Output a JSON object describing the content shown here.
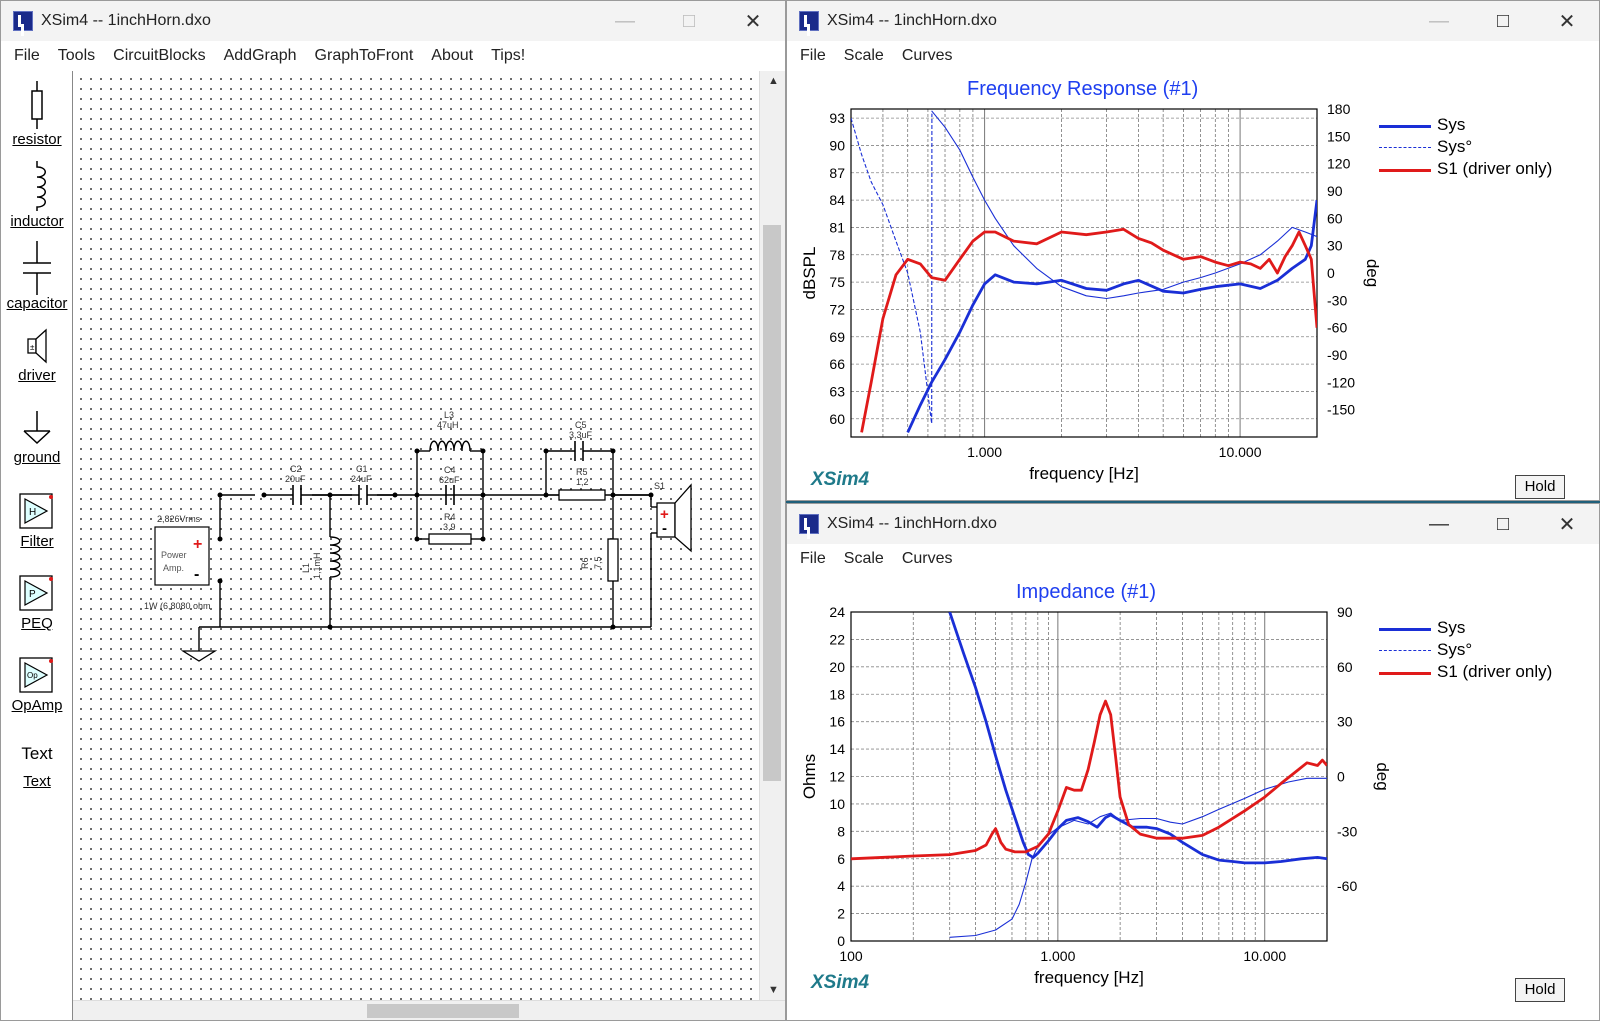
{
  "main_window": {
    "title": "XSim4 -- 1inchHorn.dxo",
    "menu": [
      "File",
      "Tools",
      "CircuitBlocks",
      "AddGraph",
      "GraphToFront",
      "About",
      "Tips!"
    ],
    "palette": [
      {
        "label": "resistor",
        "icon": "resistor-icon"
      },
      {
        "label": "inductor",
        "icon": "inductor-icon"
      },
      {
        "label": "capacitor",
        "icon": "capacitor-icon"
      },
      {
        "label": "driver",
        "icon": "driver-icon"
      },
      {
        "label": "ground",
        "icon": "ground-icon"
      },
      {
        "label": "Filter",
        "icon": "filter-icon"
      },
      {
        "label": "PEQ",
        "icon": "peq-icon"
      },
      {
        "label": "OpAmp",
        "icon": "opamp-icon"
      },
      {
        "label": "Text",
        "icon": "text-icon",
        "icon_text": "Text"
      }
    ],
    "schematic": {
      "source_voltage": "2,826Vrms",
      "amp_label_1": "Power",
      "amp_label_2": "Amp.",
      "amp_power": "1W (6,8080 ohm",
      "C2_name": "C2",
      "C2_value": "20uF",
      "C1_name": "C1",
      "C1_value": "24uF",
      "L1_name": "L1",
      "L1_value": "1,1mH",
      "L3_name": "L3",
      "L3_value": "47uH",
      "C4_name": "C4",
      "C4_value": "62uF",
      "R4_name": "R4",
      "R4_value": "3,9",
      "C5_name": "C5",
      "C5_value": "3,3uF",
      "R5_name": "R5",
      "R5_value": "1,2",
      "R6_name": "R6",
      "R6_value": "7,5",
      "S1_name": "S1"
    }
  },
  "fr_window": {
    "title": "XSim4 -- 1inchHorn.dxo",
    "menu": [
      "File",
      "Scale",
      "Curves"
    ],
    "logo": "XSim4",
    "hold": "Hold"
  },
  "imp_window": {
    "title": "XSim4 -- 1inchHorn.dxo",
    "menu": [
      "File",
      "Scale",
      "Curves"
    ],
    "logo": "XSim4",
    "hold": "Hold"
  },
  "colors": {
    "sys": "#1a2fd6",
    "driver": "#e01a1a",
    "title_blue": "#1f3ff0",
    "logo": "#1f7a8a"
  },
  "chart_data": [
    {
      "type": "line",
      "title": "Frequency Response (#1)",
      "xlabel": "frequency [Hz]",
      "ylabel": "dBSPL",
      "y2label": "deg",
      "xscale": "log",
      "xlim": [
        300,
        20000
      ],
      "ylim": [
        58,
        94
      ],
      "y2lim": [
        -180,
        180
      ],
      "xticks": [
        {
          "v": 1000,
          "label": "1.000"
        },
        {
          "v": 10000,
          "label": "10.000"
        }
      ],
      "yticks": [
        60,
        63,
        66,
        69,
        72,
        75,
        78,
        81,
        84,
        87,
        90,
        93
      ],
      "y2ticks": [
        180,
        150,
        120,
        90,
        60,
        30,
        0,
        -30,
        -60,
        -90,
        -120,
        -150
      ],
      "legend": [
        "Sys",
        "Sys°",
        "S1 (driver only)"
      ],
      "legend_position": "right",
      "grid": true,
      "series": [
        {
          "name": "Sys",
          "axis": "left",
          "style": "solid-thick",
          "color": "#1a2fd6",
          "x": [
            500,
            560,
            620,
            700,
            800,
            900,
            1000,
            1100,
            1300,
            1600,
            2000,
            2500,
            3000,
            3500,
            4000,
            5000,
            6000,
            7000,
            8000,
            10000,
            12000,
            14000,
            16000,
            18000,
            19000,
            20000
          ],
          "y": [
            58.5,
            61.5,
            64,
            66.5,
            69.5,
            72.5,
            74.8,
            75.8,
            75,
            74.8,
            75.2,
            74.3,
            74.1,
            74.8,
            75.2,
            74,
            73.8,
            74.2,
            74.5,
            74.8,
            74.3,
            75.2,
            76.5,
            77.5,
            79,
            84
          ]
        },
        {
          "name": "Sys°",
          "axis": "right",
          "style": "thin",
          "color": "#1a2fd6",
          "x": [
            620,
            700,
            800,
            900,
            1000,
            1100,
            1300,
            1600,
            2000,
            2500,
            3000,
            3500,
            4000,
            5000,
            6000,
            7000,
            8000,
            10000,
            12000,
            14000,
            16000,
            18000,
            20000
          ],
          "y": [
            178,
            160,
            135,
            105,
            80,
            60,
            30,
            5,
            -15,
            -25,
            -28,
            -25,
            -22,
            -18,
            -10,
            -5,
            0,
            10,
            20,
            35,
            50,
            45,
            40
          ]
        },
        {
          "name": "Sys°",
          "axis": "right",
          "style": "dashed",
          "color": "#1a2fd6",
          "x": [
            300,
            330,
            360,
            400,
            450,
            500,
            560,
            620,
            621,
            622
          ],
          "y": [
            170,
            130,
            100,
            75,
            35,
            0,
            -65,
            -165,
            -165,
            175
          ]
        },
        {
          "name": "S1 (driver only)",
          "axis": "left",
          "style": "solid-thick",
          "color": "#e01a1a",
          "x": [
            330,
            360,
            400,
            450,
            500,
            560,
            620,
            700,
            800,
            900,
            1000,
            1100,
            1300,
            1600,
            2000,
            2500,
            3000,
            3500,
            4000,
            4500,
            5000,
            6000,
            7000,
            8000,
            9000,
            10000,
            11000,
            12000,
            13000,
            14000,
            15000,
            16000,
            17000,
            18000,
            19000,
            20000
          ],
          "y": [
            58.5,
            64,
            71,
            75.8,
            77.5,
            77,
            75.5,
            75.2,
            77.5,
            79.5,
            80.5,
            80.5,
            79.5,
            79.2,
            80.5,
            80.2,
            80.5,
            80.8,
            79.8,
            79.3,
            78.5,
            77.5,
            77.8,
            77.2,
            76.8,
            77.2,
            77,
            76.5,
            77.5,
            76,
            77.8,
            79,
            80.5,
            79,
            77.5,
            70
          ]
        }
      ]
    },
    {
      "type": "line",
      "title": "Impedance (#1)",
      "xlabel": "frequency [Hz]",
      "ylabel": "Ohms",
      "y2label": "deg",
      "xscale": "log",
      "xlim": [
        100,
        20000
      ],
      "ylim": [
        0,
        24
      ],
      "y2lim": [
        -90,
        90
      ],
      "xticks": [
        {
          "v": 100,
          "label": "100"
        },
        {
          "v": 1000,
          "label": "1.000"
        },
        {
          "v": 10000,
          "label": "10.000"
        }
      ],
      "yticks": [
        0,
        2,
        4,
        6,
        8,
        10,
        12,
        14,
        16,
        18,
        20,
        22,
        24
      ],
      "y2ticks": [
        90,
        60,
        30,
        0,
        -30,
        -60
      ],
      "legend": [
        "Sys",
        "Sys°",
        "S1 (driver only)"
      ],
      "legend_position": "right",
      "grid": true,
      "series": [
        {
          "name": "Sys",
          "axis": "left",
          "style": "solid-thick",
          "color": "#1a2fd6",
          "x": [
            300,
            350,
            400,
            450,
            500,
            560,
            620,
            680,
            720,
            760,
            800,
            900,
            1000,
            1100,
            1250,
            1400,
            1550,
            1700,
            1800,
            2000,
            2300,
            2700,
            3000,
            3500,
            4000,
            5000,
            6000,
            7000,
            8000,
            10000,
            12000,
            15000,
            18000,
            20000
          ],
          "y": [
            24,
            21,
            18.5,
            16,
            13.5,
            11,
            9,
            7.2,
            6.3,
            6.1,
            6.4,
            7.3,
            8.2,
            8.8,
            9,
            8.7,
            8.3,
            9,
            9.2,
            8.8,
            8.3,
            8.3,
            8.2,
            7.8,
            7.2,
            6.3,
            5.9,
            5.8,
            5.7,
            5.7,
            5.8,
            6,
            6.1,
            6
          ]
        },
        {
          "name": "Sys°",
          "axis": "right",
          "style": "thin",
          "color": "#1a2fd6",
          "x": [
            300,
            400,
            500,
            600,
            650,
            700,
            750,
            800,
            900,
            1000,
            1200,
            1400,
            1600,
            1800,
            2000,
            2500,
            3000,
            3500,
            4000,
            5000,
            6000,
            8000,
            10000,
            13000,
            16000,
            20000
          ],
          "y": [
            -88,
            -87,
            -84,
            -78,
            -70,
            -58,
            -45,
            -38,
            -32,
            -28,
            -24,
            -26,
            -22,
            -20,
            -24,
            -23,
            -23,
            -25,
            -26,
            -22,
            -18,
            -12,
            -7,
            -3,
            -1,
            -1
          ]
        },
        {
          "name": "S1 (driver only)",
          "axis": "left",
          "style": "solid-thick",
          "color": "#e01a1a",
          "x": [
            100,
            200,
            300,
            400,
            450,
            480,
            500,
            530,
            560,
            620,
            700,
            800,
            900,
            1000,
            1100,
            1200,
            1300,
            1400,
            1500,
            1600,
            1700,
            1800,
            1900,
            2000,
            2200,
            2500,
            3000,
            4000,
            5000,
            6000,
            8000,
            10000,
            12000,
            14000,
            16000,
            18000,
            19000,
            20000
          ],
          "y": [
            6,
            6.2,
            6.3,
            6.6,
            7,
            7.8,
            8.2,
            7.2,
            6.7,
            6.5,
            6.5,
            6.9,
            7.8,
            9.5,
            11.2,
            11,
            11,
            12.5,
            14.5,
            16.5,
            17.5,
            16.5,
            13.5,
            10.5,
            8.5,
            7.8,
            7.5,
            7.5,
            7.7,
            8.3,
            9.5,
            10.5,
            11.5,
            12.3,
            13,
            12.8,
            13.2,
            12.8
          ]
        }
      ]
    }
  ]
}
